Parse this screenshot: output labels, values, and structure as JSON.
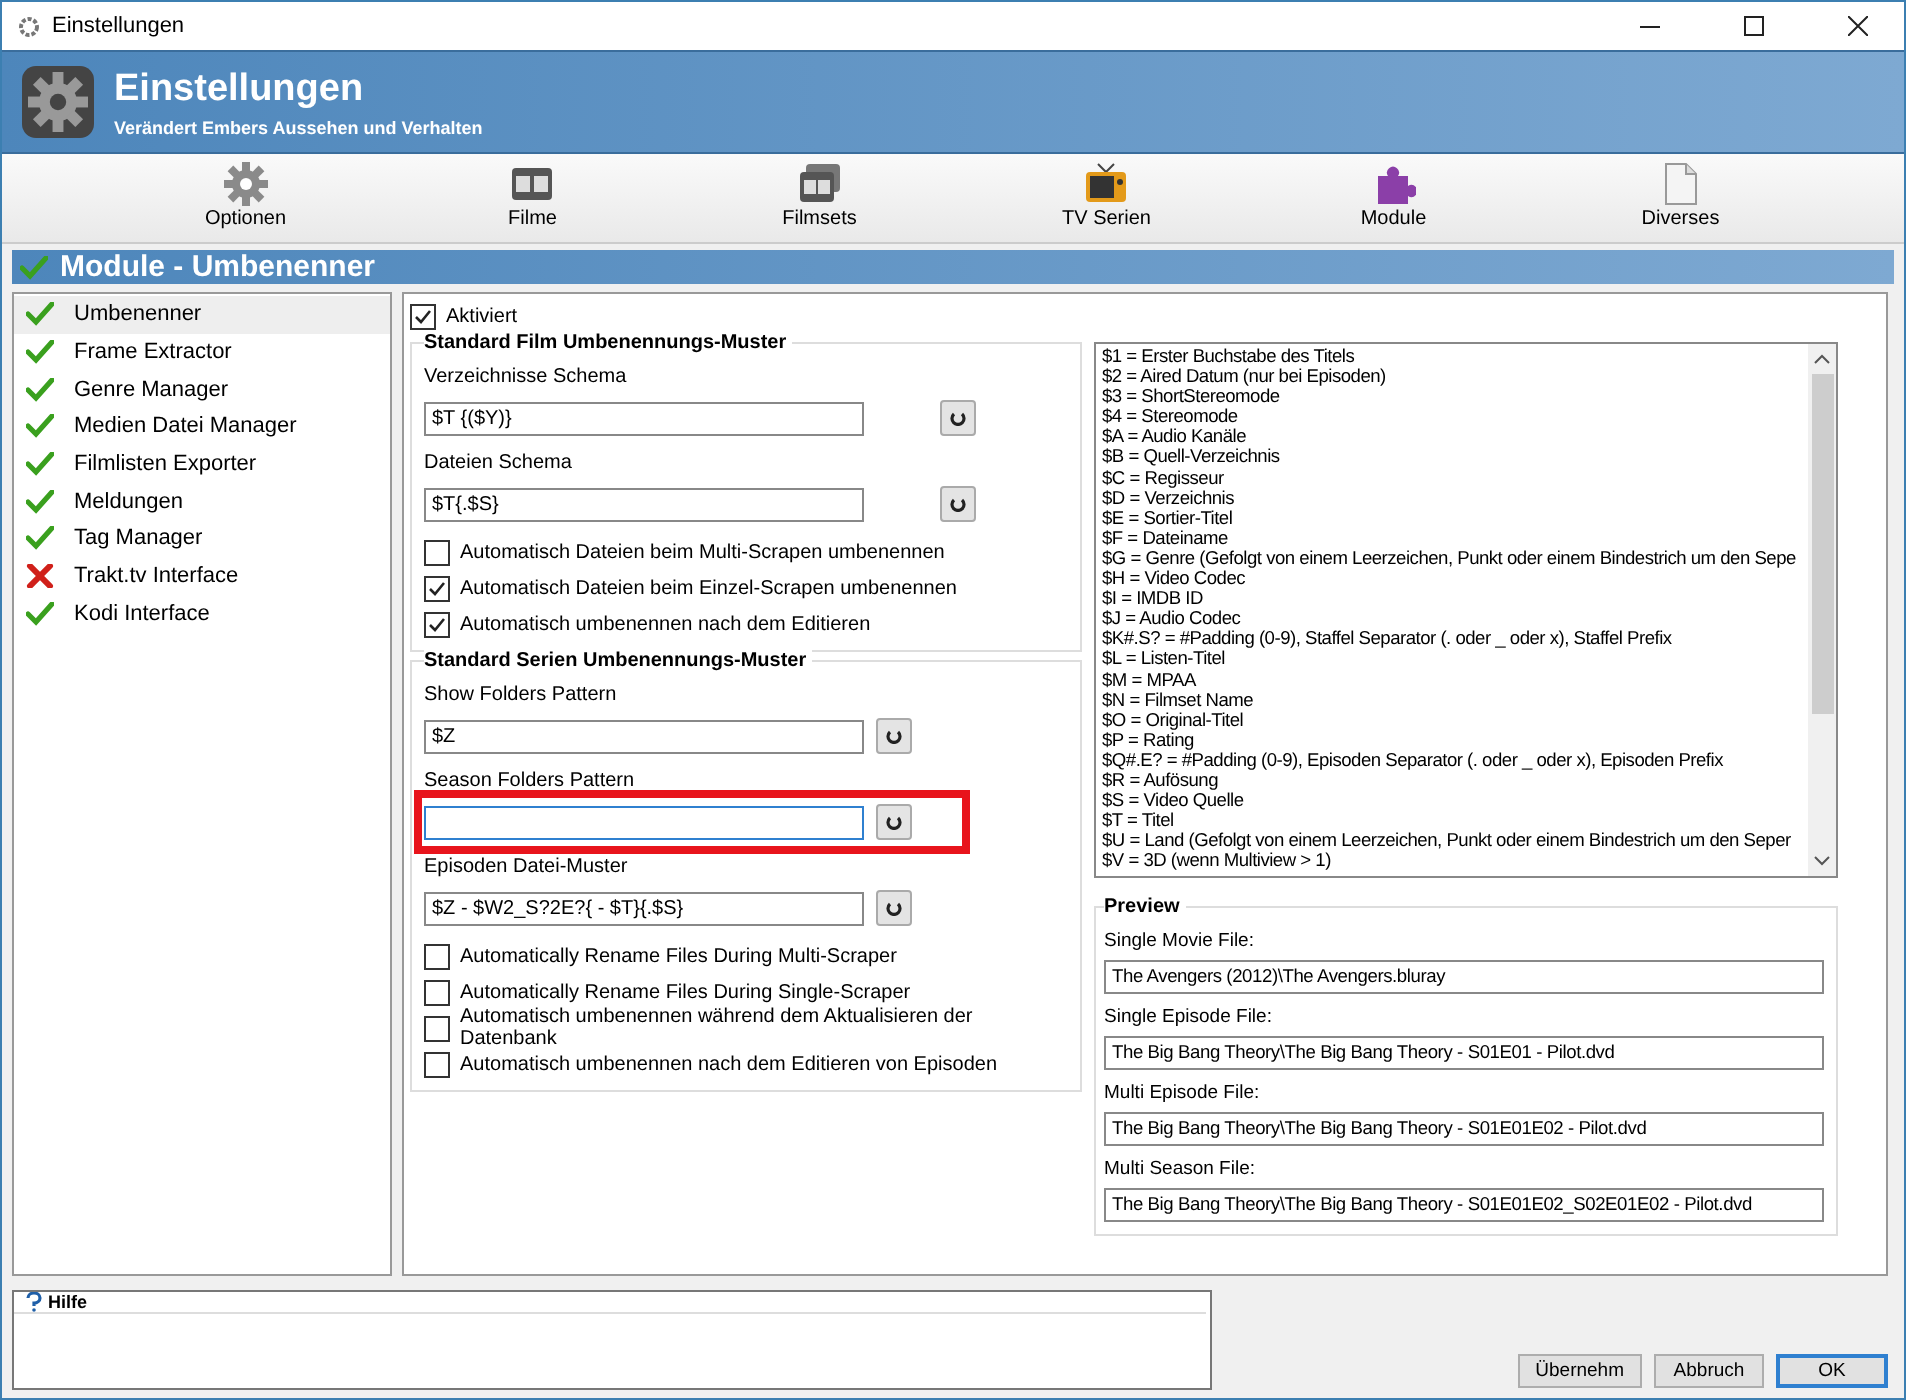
{
  "window": {
    "title": "Einstellungen"
  },
  "header": {
    "title": "Einstellungen",
    "subtitle": "Verändert Embers Aussehen und Verhalten"
  },
  "toolbar": [
    {
      "label": "Optionen",
      "kind": "gear"
    },
    {
      "label": "Filme",
      "kind": "film"
    },
    {
      "label": "Filmsets",
      "kind": "filmset"
    },
    {
      "label": "TV Serien",
      "kind": "tv"
    },
    {
      "label": "Module",
      "kind": "puzzle"
    },
    {
      "label": "Diverses",
      "kind": "document"
    }
  ],
  "section_title": "Module - Umbenenner",
  "sidebar": {
    "items": [
      {
        "label": "Umbenenner",
        "enabled": true,
        "selected": true
      },
      {
        "label": "Frame Extractor",
        "enabled": true,
        "selected": false
      },
      {
        "label": "Genre Manager",
        "enabled": true,
        "selected": false
      },
      {
        "label": "Medien Datei Manager",
        "enabled": true,
        "selected": false
      },
      {
        "label": "Filmlisten Exporter",
        "enabled": true,
        "selected": false
      },
      {
        "label": "Meldungen",
        "enabled": true,
        "selected": false
      },
      {
        "label": "Tag Manager",
        "enabled": true,
        "selected": false
      },
      {
        "label": "Trakt.tv Interface",
        "enabled": false,
        "selected": false
      },
      {
        "label": "Kodi Interface",
        "enabled": true,
        "selected": false
      }
    ]
  },
  "enabled_checkbox": {
    "label": "Aktiviert",
    "checked": true
  },
  "movie_group": {
    "title": "Standard Film Umbenennungs-Muster",
    "fields": [
      {
        "label": "Verzeichnisse Schema",
        "value": "$T {($Y)}",
        "highlighted": false
      },
      {
        "label": "Dateien Schema",
        "value": "$T{.$S}",
        "highlighted": false
      }
    ],
    "options": [
      {
        "label": "Automatisch Dateien beim Multi-Scrapen umbenennen",
        "checked": false
      },
      {
        "label": "Automatisch Dateien beim Einzel-Scrapen umbenennen",
        "checked": true
      },
      {
        "label": "Automatisch umbenennen nach dem Editieren",
        "checked": true
      }
    ]
  },
  "series_group": {
    "title": "Standard Serien Umbenennungs-Muster",
    "fields": [
      {
        "label": "Show Folders Pattern",
        "value": "$Z",
        "highlighted": false
      },
      {
        "label": "Season Folders Pattern",
        "highlighted": true
      },
      {
        "label": "Episoden Datei-Muster",
        "value": "$Z - $W2_S?2E?{ - $T}{.$S}",
        "highlighted": false
      }
    ],
    "options": [
      {
        "label": "Automatically Rename Files During Multi-Scraper",
        "checked": false
      },
      {
        "label": "Automatically Rename Files During Single-Scraper",
        "checked": false
      },
      {
        "label": "Automatisch umbenennen während dem Aktualisieren der Datenbank",
        "checked": false
      },
      {
        "label": "Automatisch umbenennen nach dem Editieren von Episoden",
        "checked": false
      }
    ]
  },
  "placeholder_list": [
    "$1 = Erster Buchstabe des Titels",
    "$2 = Aired Datum (nur bei Episoden)",
    "$3 = ShortStereomode",
    "$4 = Stereomode",
    "$A = Audio Kanäle",
    "$B = Quell-Verzeichnis",
    "$C = Regisseur",
    "$D = Verzeichnis",
    "$E = Sortier-Titel",
    "$F = Dateiname",
    "$G = Genre (Gefolgt von einem Leerzeichen, Punkt oder einem Bindestrich um den Sepe",
    "$H = Video Codec",
    "$I = IMDB ID",
    "$J = Audio Codec",
    "$K#.S? = #Padding (0-9), Staffel Separator (. oder _ oder x), Staffel Prefix",
    "$L = Listen-Titel",
    "$M = MPAA",
    "$N = Filmset Name",
    "$O = Original-Titel",
    "$P = Rating",
    "$Q#.E? = #Padding (0-9), Episoden Separator (. oder _ oder x), Episoden Prefix",
    "$R = Aufösung",
    "$S = Video Quelle",
    "$T = Titel",
    "$U = Land (Gefolgt von einem Leerzeichen, Punkt oder einem Bindestrich um den Seper",
    "$V = 3D (wenn Multiview > 1)"
  ],
  "preview": {
    "title": "Preview",
    "items": [
      {
        "label": "Single Movie File:",
        "value": "The Avengers (2012)\\The Avengers.bluray"
      },
      {
        "label": "Single Episode File:",
        "value": "The Big Bang Theory\\The Big Bang Theory - S01E01 - Pilot.dvd"
      },
      {
        "label": "Multi Episode File:",
        "value": "The Big Bang Theory\\The Big Bang Theory - S01E01E02 - Pilot.dvd"
      },
      {
        "label": "Multi Season File:",
        "value": "The Big Bang Theory\\The Big Bang Theory - S01E01E02_S02E01E02 - Pilot.dvd"
      }
    ]
  },
  "help": {
    "title": "Hilfe"
  },
  "buttons": [
    {
      "label": "Übernehm",
      "default": false
    },
    {
      "label": "Abbruch",
      "default": false
    },
    {
      "label": "OK",
      "default": true
    }
  ]
}
